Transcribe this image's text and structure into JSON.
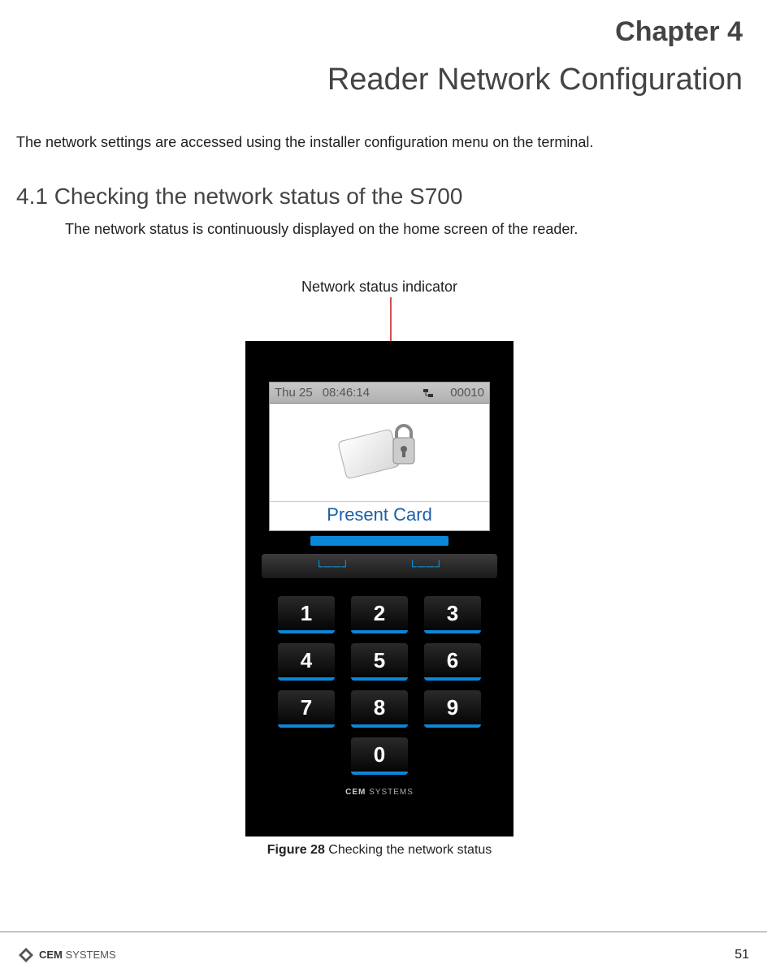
{
  "chapter": {
    "label": "Chapter 4",
    "title": "Reader Network Configuration"
  },
  "intro": "The network settings are accessed using the installer configuration menu on the terminal.",
  "section": {
    "number": "4.1",
    "heading": "4.1  Checking the network status of the S700",
    "body": "The network status is continuously displayed on the home screen of the reader."
  },
  "callout": "Network status indicator",
  "device": {
    "status": {
      "date": "Thu 25",
      "time": "08:46:14",
      "count": "00010"
    },
    "present_card": "Present Card",
    "keys": [
      "1",
      "2",
      "3",
      "4",
      "5",
      "6",
      "7",
      "8",
      "9",
      "0"
    ],
    "brand_bold": "CEM",
    "brand_rest": " SYSTEMS"
  },
  "figure": {
    "label": "Figure 28",
    "caption": " Checking the network status"
  },
  "footer": {
    "brand_bold": "CEM",
    "brand_rest": " SYSTEMS",
    "page": "51"
  }
}
